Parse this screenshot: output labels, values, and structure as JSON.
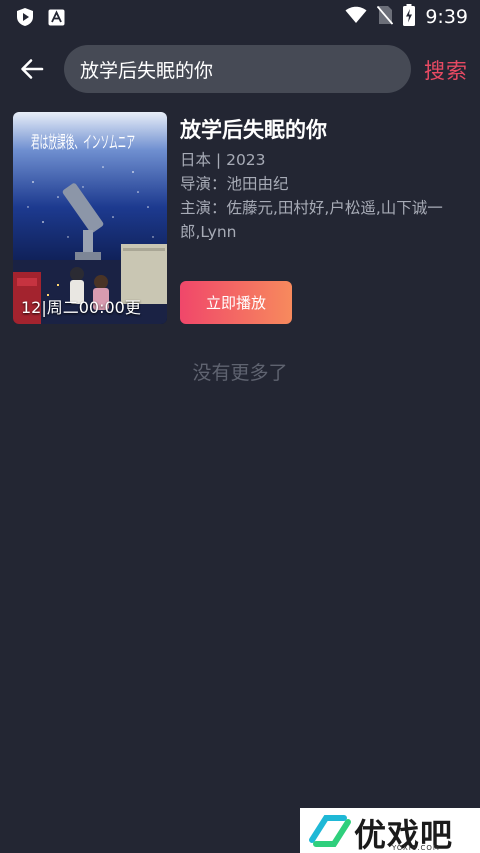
{
  "status_bar": {
    "time": "9:39",
    "icons": [
      "shield-play-icon",
      "font-a-icon",
      "wifi-icon",
      "no-sim-icon",
      "battery-charging-icon"
    ]
  },
  "top_bar": {
    "search_value": "放学后失眠的你",
    "search_button_label": "搜索"
  },
  "result": {
    "title": "放学后失眠的你",
    "region_year": "日本 | 2023",
    "director": "导演：池田由纪",
    "cast": "主演：佐藤元,田村好,户松遥,山下诚一郎,Lynn",
    "poster_caption": "12|周二00:00更",
    "poster_title_art": "君は放課後、インソムニア",
    "play_button_label": "立即播放"
  },
  "footer": {
    "no_more": "没有更多了"
  },
  "watermark": {
    "text": "优戏吧",
    "sub": "YOXI8.COM"
  },
  "colors": {
    "background": "#232633",
    "accent": "#e84a63",
    "search_bg": "#464a55",
    "meta_text": "#a7abb6"
  }
}
